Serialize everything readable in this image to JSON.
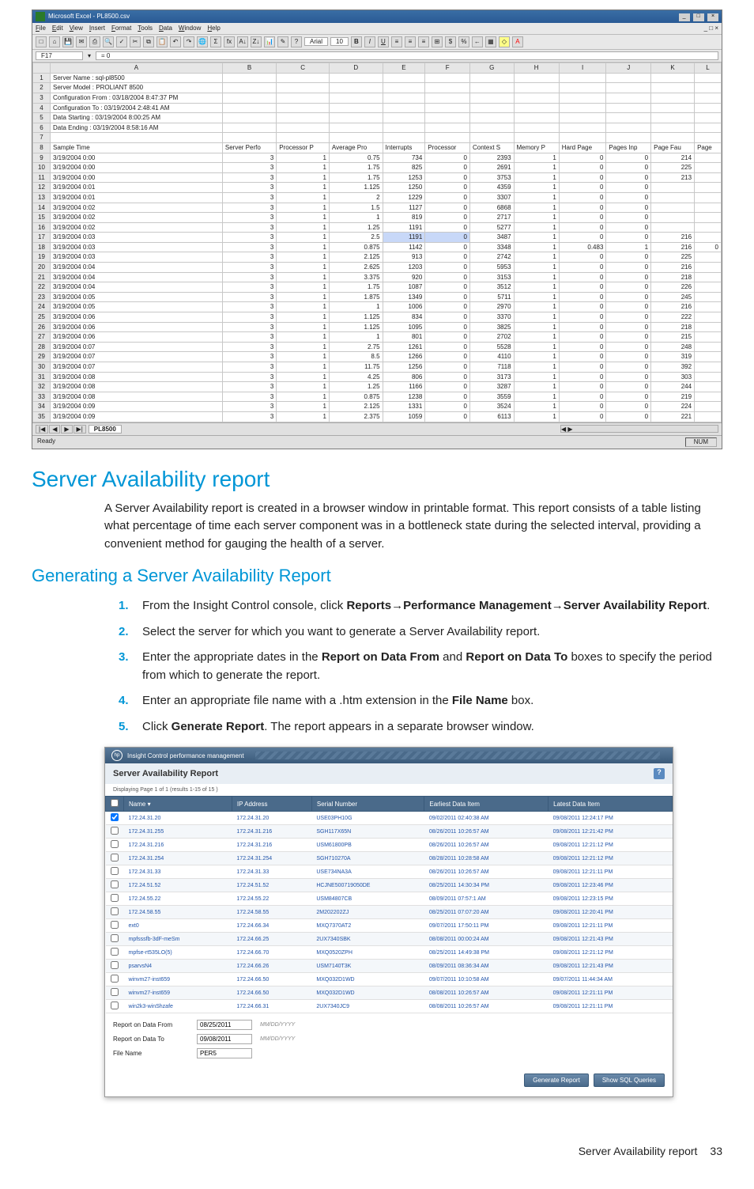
{
  "excel": {
    "title": "Microsoft Excel - PL8500.csv",
    "menus": [
      "File",
      "Edit",
      "View",
      "Insert",
      "Format",
      "Tools",
      "Data",
      "Window",
      "Help"
    ],
    "font_name": "Arial",
    "font_size": "10",
    "cell_ref": "F17",
    "cell_val": "= 0",
    "columns": [
      "",
      "A",
      "B",
      "C",
      "D",
      "E",
      "F",
      "G",
      "H",
      "I",
      "J",
      "K",
      "L"
    ],
    "info_rows": [
      {
        "n": "1",
        "a": "Server Name : sql-pl8500"
      },
      {
        "n": "2",
        "a": "Server Model : PROLIANT 8500"
      },
      {
        "n": "3",
        "a": "Configuration From : 03/18/2004 8:47:37 PM"
      },
      {
        "n": "4",
        "a": "Configuration To : 03/19/2004 2:48:41 AM"
      },
      {
        "n": "5",
        "a": "Data Starting : 03/19/2004 8:00:25 AM"
      },
      {
        "n": "6",
        "a": "Data Ending : 03/19/2004 8:58:16 AM"
      },
      {
        "n": "7",
        "a": ""
      }
    ],
    "header_row_num": "8",
    "headers": [
      "Sample Time",
      "Server Perfo",
      "Processor P",
      "Average Pro",
      "Interrupts",
      "Processor",
      "Context S",
      "Memory P",
      "Hard Page",
      "Pages Inp",
      "Page Fau",
      "Page"
    ],
    "data_rows": [
      {
        "n": "9",
        "a": "3/19/2004 0:00",
        "b": "3",
        "c": "1",
        "d": "0.75",
        "e": "734",
        "f": "0",
        "g": "2393",
        "h": "1",
        "i": "0",
        "j": "0",
        "k": "214",
        "l": ""
      },
      {
        "n": "10",
        "a": "3/19/2004 0:00",
        "b": "3",
        "c": "1",
        "d": "1.75",
        "e": "825",
        "f": "0",
        "g": "2691",
        "h": "1",
        "i": "0",
        "j": "0",
        "k": "225",
        "l": ""
      },
      {
        "n": "11",
        "a": "3/19/2004 0:00",
        "b": "3",
        "c": "1",
        "d": "1.75",
        "e": "1253",
        "f": "0",
        "g": "3753",
        "h": "1",
        "i": "0",
        "j": "0",
        "k": "213",
        "l": ""
      },
      {
        "n": "12",
        "a": "3/19/2004 0:01",
        "b": "3",
        "c": "1",
        "d": "1.125",
        "e": "1250",
        "f": "0",
        "g": "4359",
        "h": "1",
        "i": "0",
        "j": "0",
        "k": "",
        "l": ""
      },
      {
        "n": "13",
        "a": "3/19/2004 0:01",
        "b": "3",
        "c": "1",
        "d": "2",
        "e": "1229",
        "f": "0",
        "g": "3307",
        "h": "1",
        "i": "0",
        "j": "0",
        "k": "",
        "l": ""
      },
      {
        "n": "14",
        "a": "3/19/2004 0:02",
        "b": "3",
        "c": "1",
        "d": "1.5",
        "e": "1127",
        "f": "0",
        "g": "6868",
        "h": "1",
        "i": "0",
        "j": "0",
        "k": "",
        "l": ""
      },
      {
        "n": "15",
        "a": "3/19/2004 0:02",
        "b": "3",
        "c": "1",
        "d": "1",
        "e": "819",
        "f": "0",
        "g": "2717",
        "h": "1",
        "i": "0",
        "j": "0",
        "k": "",
        "l": ""
      },
      {
        "n": "16",
        "a": "3/19/2004 0:02",
        "b": "3",
        "c": "1",
        "d": "1.25",
        "e": "1191",
        "f": "0",
        "g": "5277",
        "h": "1",
        "i": "0",
        "j": "0",
        "k": "",
        "l": ""
      },
      {
        "n": "17",
        "a": "3/19/2004 0:03",
        "b": "3",
        "c": "1",
        "d": "2.5",
        "e": "1191",
        "f": "0",
        "g": "3487",
        "h": "1",
        "i": "0",
        "j": "0",
        "k": "216",
        "l": "",
        "sel": true
      },
      {
        "n": "18",
        "a": "3/19/2004 0:03",
        "b": "3",
        "c": "1",
        "d": "0.875",
        "e": "1142",
        "f": "0",
        "g": "3348",
        "h": "1",
        "i": "0.483",
        "j": "1",
        "k": "216",
        "l": "0"
      },
      {
        "n": "19",
        "a": "3/19/2004 0:03",
        "b": "3",
        "c": "1",
        "d": "2.125",
        "e": "913",
        "f": "0",
        "g": "2742",
        "h": "1",
        "i": "0",
        "j": "0",
        "k": "225",
        "l": ""
      },
      {
        "n": "20",
        "a": "3/19/2004 0:04",
        "b": "3",
        "c": "1",
        "d": "2.625",
        "e": "1203",
        "f": "0",
        "g": "5953",
        "h": "1",
        "i": "0",
        "j": "0",
        "k": "216",
        "l": ""
      },
      {
        "n": "21",
        "a": "3/19/2004 0:04",
        "b": "3",
        "c": "1",
        "d": "3.375",
        "e": "920",
        "f": "0",
        "g": "3153",
        "h": "1",
        "i": "0",
        "j": "0",
        "k": "218",
        "l": ""
      },
      {
        "n": "22",
        "a": "3/19/2004 0:04",
        "b": "3",
        "c": "1",
        "d": "1.75",
        "e": "1087",
        "f": "0",
        "g": "3512",
        "h": "1",
        "i": "0",
        "j": "0",
        "k": "226",
        "l": ""
      },
      {
        "n": "23",
        "a": "3/19/2004 0:05",
        "b": "3",
        "c": "1",
        "d": "1.875",
        "e": "1349",
        "f": "0",
        "g": "5711",
        "h": "1",
        "i": "0",
        "j": "0",
        "k": "245",
        "l": ""
      },
      {
        "n": "24",
        "a": "3/19/2004 0:05",
        "b": "3",
        "c": "1",
        "d": "1",
        "e": "1006",
        "f": "0",
        "g": "2970",
        "h": "1",
        "i": "0",
        "j": "0",
        "k": "216",
        "l": ""
      },
      {
        "n": "25",
        "a": "3/19/2004 0:06",
        "b": "3",
        "c": "1",
        "d": "1.125",
        "e": "834",
        "f": "0",
        "g": "3370",
        "h": "1",
        "i": "0",
        "j": "0",
        "k": "222",
        "l": ""
      },
      {
        "n": "26",
        "a": "3/19/2004 0:06",
        "b": "3",
        "c": "1",
        "d": "1.125",
        "e": "1095",
        "f": "0",
        "g": "3825",
        "h": "1",
        "i": "0",
        "j": "0",
        "k": "218",
        "l": ""
      },
      {
        "n": "27",
        "a": "3/19/2004 0:06",
        "b": "3",
        "c": "1",
        "d": "1",
        "e": "801",
        "f": "0",
        "g": "2702",
        "h": "1",
        "i": "0",
        "j": "0",
        "k": "215",
        "l": ""
      },
      {
        "n": "28",
        "a": "3/19/2004 0:07",
        "b": "3",
        "c": "1",
        "d": "2.75",
        "e": "1261",
        "f": "0",
        "g": "5528",
        "h": "1",
        "i": "0",
        "j": "0",
        "k": "248",
        "l": ""
      },
      {
        "n": "29",
        "a": "3/19/2004 0:07",
        "b": "3",
        "c": "1",
        "d": "8.5",
        "e": "1266",
        "f": "0",
        "g": "4110",
        "h": "1",
        "i": "0",
        "j": "0",
        "k": "319",
        "l": ""
      },
      {
        "n": "30",
        "a": "3/19/2004 0:07",
        "b": "3",
        "c": "1",
        "d": "11.75",
        "e": "1256",
        "f": "0",
        "g": "7118",
        "h": "1",
        "i": "0",
        "j": "0",
        "k": "392",
        "l": ""
      },
      {
        "n": "31",
        "a": "3/19/2004 0:08",
        "b": "3",
        "c": "1",
        "d": "4.25",
        "e": "806",
        "f": "0",
        "g": "3173",
        "h": "1",
        "i": "0",
        "j": "0",
        "k": "303",
        "l": ""
      },
      {
        "n": "32",
        "a": "3/19/2004 0:08",
        "b": "3",
        "c": "1",
        "d": "1.25",
        "e": "1166",
        "f": "0",
        "g": "3287",
        "h": "1",
        "i": "0",
        "j": "0",
        "k": "244",
        "l": ""
      },
      {
        "n": "33",
        "a": "3/19/2004 0:08",
        "b": "3",
        "c": "1",
        "d": "0.875",
        "e": "1238",
        "f": "0",
        "g": "3559",
        "h": "1",
        "i": "0",
        "j": "0",
        "k": "219",
        "l": ""
      },
      {
        "n": "34",
        "a": "3/19/2004 0:09",
        "b": "3",
        "c": "1",
        "d": "2.125",
        "e": "1331",
        "f": "0",
        "g": "3524",
        "h": "1",
        "i": "0",
        "j": "0",
        "k": "224",
        "l": ""
      },
      {
        "n": "35",
        "a": "3/19/2004 0:09",
        "b": "3",
        "c": "1",
        "d": "2.375",
        "e": "1059",
        "f": "0",
        "g": "6113",
        "h": "1",
        "i": "0",
        "j": "0",
        "k": "221",
        "l": ""
      }
    ],
    "sheet_tab": "PL8500",
    "status_left": "Ready",
    "status_right": "NUM"
  },
  "doc": {
    "h1": "Server Availability report",
    "p1": "A Server Availability report is created in a browser window in printable format. This report consists of a table listing what percentage of time each server component was in a bottleneck state during the selected interval, providing a convenient method for gauging the health of a server.",
    "h2": "Generating a Server Availability Report",
    "steps": [
      {
        "n": "1.",
        "pre": "From the Insight Control console, click ",
        "b1": "Reports",
        "arr1": "→",
        "b2": "Performance Management",
        "arr2": "→",
        "b3": "Server Availability Report",
        "post": "."
      },
      {
        "n": "2.",
        "txt": "Select the server for which you want to generate a Server Availability report."
      },
      {
        "n": "3.",
        "pre": "Enter the appropriate dates in the ",
        "b1": "Report on Data From",
        "mid": " and ",
        "b2": "Report on Data To",
        "post": " boxes to specify the period from which to generate the report."
      },
      {
        "n": "4.",
        "pre": "Enter an appropriate file name with a .htm extension in the ",
        "b1": "File Name",
        "post": " box."
      },
      {
        "n": "5.",
        "pre": "Click ",
        "b1": "Generate Report",
        "post": ". The report appears in a separate browser window."
      }
    ]
  },
  "ic": {
    "title": "Insight Control performance management",
    "report_title": "Server Availability Report",
    "paging": "Displaying Page 1 of 1 (results 1-15 of 15 )",
    "cols": [
      "",
      "Name",
      "IP Address",
      "Serial Number",
      "Earliest Data Item",
      "Latest Data Item"
    ],
    "rows": [
      {
        "cb": true,
        "name": "172.24.31.20",
        "ip": "172.24.31.20",
        "sn": "USE03PH10G",
        "early": "09/02/2011 02:40:38 AM",
        "late": "09/08/2011 12:24:17 PM"
      },
      {
        "cb": false,
        "name": "172.24.31.255",
        "ip": "172.24.31.216",
        "sn": "SGH117X65N",
        "early": "08/26/2011 10:26:57 AM",
        "late": "09/08/2011 12:21:42 PM"
      },
      {
        "cb": false,
        "name": "172.24.31.216",
        "ip": "172.24.31.216",
        "sn": "USM61800PB",
        "early": "08/26/2011 10:26:57 AM",
        "late": "09/08/2011 12:21:12 PM"
      },
      {
        "cb": false,
        "name": "172.24.31.254",
        "ip": "172.24.31.254",
        "sn": "SGH710270A",
        "early": "08/28/2011 10:28:58 AM",
        "late": "09/08/2011 12:21:12 PM"
      },
      {
        "cb": false,
        "name": "172.24.31.33",
        "ip": "172.24.31.33",
        "sn": "USE734NA3A",
        "early": "08/26/2011 10:26:57 AM",
        "late": "09/08/2011 12:21:11 PM"
      },
      {
        "cb": false,
        "name": "172.24.51.52",
        "ip": "172.24.51.52",
        "sn": "HCJNE500719050DE",
        "early": "08/25/2011 14:30:34 PM",
        "late": "09/08/2011 12:23:46 PM"
      },
      {
        "cb": false,
        "name": "172.24.55.22",
        "ip": "172.24.55.22",
        "sn": "USM84807CB",
        "early": "08/09/2011 07:57:1 AM",
        "late": "09/08/2011 12:23:15 PM"
      },
      {
        "cb": false,
        "name": "172.24.58.55",
        "ip": "172.24.58.55",
        "sn": "2M202202ZJ",
        "early": "08/25/2011 07:07:20 AM",
        "late": "09/08/2011 12:20:41 PM"
      },
      {
        "cb": false,
        "name": "ext0",
        "ip": "172.24.66.34",
        "sn": "MXQ7370AT2",
        "early": "09/07/2011 17:50:11 PM",
        "late": "09/08/2011 12:21:11 PM"
      },
      {
        "cb": false,
        "name": "mpfsssfb-3dF-meSm",
        "ip": "172.24.66.25",
        "sn": "2UX7340SBK",
        "early": "08/08/2011 00:00:24 AM",
        "late": "09/08/2011 12:21:43 PM"
      },
      {
        "cb": false,
        "name": "mpfse-rt535LO(5)",
        "ip": "172.24.66.70",
        "sn": "MXQ0520ZPH",
        "early": "08/25/2011 14:49:38 PM",
        "late": "09/08/2011 12:21:12 PM"
      },
      {
        "cb": false,
        "name": "psarvsN4",
        "ip": "172.24.66.26",
        "sn": "USM7140T3K",
        "early": "08/09/2011 08:36:34 AM",
        "late": "09/08/2011 12:21:43 PM"
      },
      {
        "cb": false,
        "name": "winvm27-inst659",
        "ip": "172.24.66.50",
        "sn": "MXQ032D1WD",
        "early": "09/07/2011 10:10:58 AM",
        "late": "09/07/2011 11:44:34 AM"
      },
      {
        "cb": false,
        "name": "winvm27-inst659",
        "ip": "172.24.66.50",
        "sn": "MXQ032D1WD",
        "early": "08/08/2011 10:26:57 AM",
        "late": "09/08/2011 12:21:11 PM"
      },
      {
        "cb": false,
        "name": "win2k3-winShzafe",
        "ip": "172.24.66.31",
        "sn": "2UX7340JC9",
        "early": "08/08/2011 10:26:57 AM",
        "late": "09/08/2011 12:21:11 PM"
      }
    ],
    "form": {
      "from_label": "Report on Data From",
      "from_value": "08/25/2011",
      "to_label": "Report on Data To",
      "to_value": "09/08/2011",
      "date_hint": "MM/DD/YYYY",
      "file_label": "File Name",
      "file_value": "PER5"
    },
    "btn_generate": "Generate Report",
    "btn_show_sql": "Show SQL Queries"
  },
  "footer": {
    "section": "Server Availability report",
    "page": "33"
  }
}
